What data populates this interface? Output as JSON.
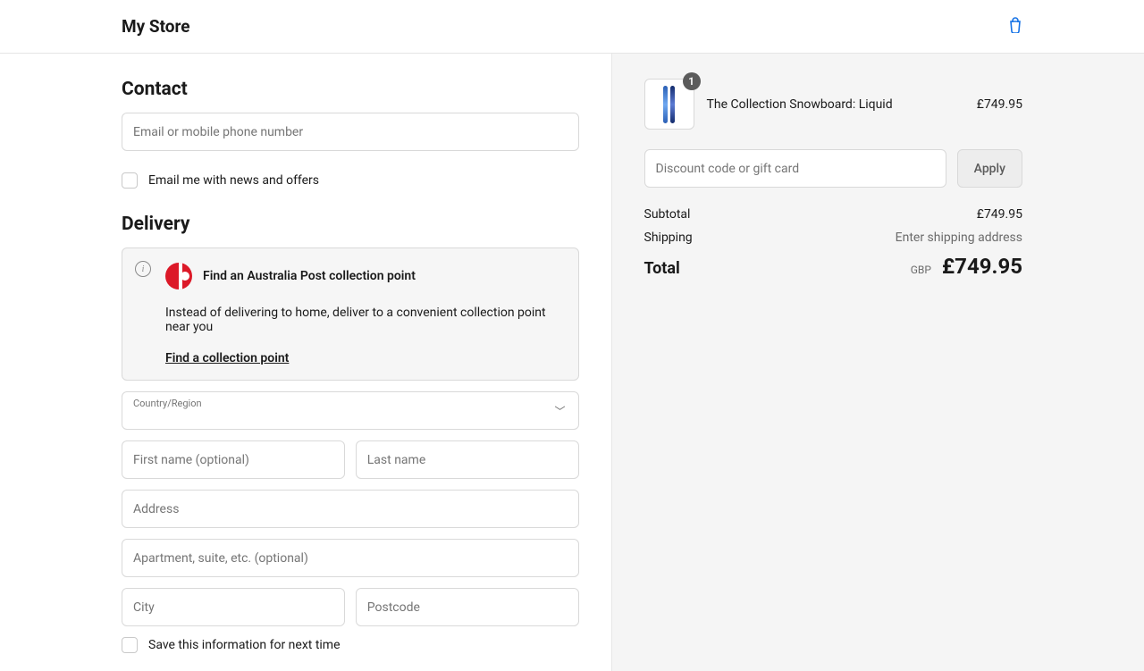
{
  "header": {
    "store_name": "My Store"
  },
  "contact": {
    "heading": "Contact",
    "email_placeholder": "Email or mobile phone number",
    "news_label": "Email me with news and offers"
  },
  "delivery": {
    "heading": "Delivery",
    "notice": {
      "title": "Find an Australia Post collection point",
      "body": "Instead of delivering to home, deliver to a convenient collection point near you",
      "link": "Find a collection point"
    },
    "country_label": "Country/Region",
    "first_name_placeholder": "First name (optional)",
    "last_name_placeholder": "Last name",
    "address_placeholder": "Address",
    "apartment_placeholder": "Apartment, suite, etc. (optional)",
    "city_placeholder": "City",
    "postcode_placeholder": "Postcode",
    "save_label": "Save this information for next time"
  },
  "cart": {
    "item": {
      "name": "The Collection Snowboard: Liquid",
      "price": "£749.95",
      "qty": "1"
    },
    "discount_placeholder": "Discount code or gift card",
    "apply_label": "Apply",
    "subtotal_label": "Subtotal",
    "subtotal_value": "£749.95",
    "shipping_label": "Shipping",
    "shipping_value": "Enter shipping address",
    "total_label": "Total",
    "currency": "GBP",
    "total_value": "£749.95"
  }
}
